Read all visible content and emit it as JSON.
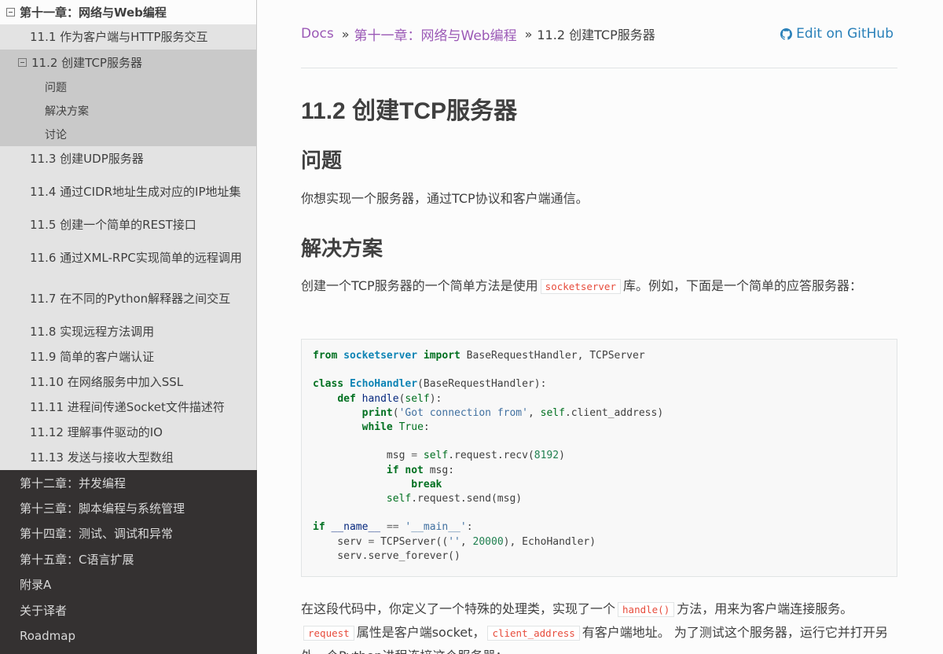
{
  "sidebar": {
    "current_chapter": "第十一章：网络与Web编程",
    "sections_before": [
      "11.1 作为客户端与HTTP服务交互"
    ],
    "current_section": {
      "label": "11.2 创建TCP服务器",
      "subsections": [
        "问题",
        "解决方案",
        "讨论"
      ]
    },
    "sections_after": [
      {
        "label": "11.3 创建UDP服务器",
        "lines": 1
      },
      {
        "label": "11.4 通过CIDR地址生成对应的IP地址集",
        "lines": 2
      },
      {
        "label": "11.5 创建一个简单的REST接口",
        "lines": 1
      },
      {
        "label": "11.6 通过XML-RPC实现简单的远程调用",
        "lines": 2
      },
      {
        "label": "11.7 在不同的Python解释器之间交互",
        "lines": 2
      },
      {
        "label": "11.8 实现远程方法调用",
        "lines": 1
      },
      {
        "label": "11.9 简单的客户端认证",
        "lines": 1
      },
      {
        "label": "11.10 在网络服务中加入SSL",
        "lines": 1
      },
      {
        "label": "11.11 进程间传递Socket文件描述符",
        "lines": 1
      },
      {
        "label": "11.12 理解事件驱动的IO",
        "lines": 1
      },
      {
        "label": "11.13 发送与接收大型数组",
        "lines": 1
      }
    ],
    "other_chapters": [
      "第十二章：并发编程",
      "第十三章：脚本编程与系统管理",
      "第十四章：测试、调试和异常",
      "第十五章：C语言扩展",
      "附录A",
      "关于译者",
      "Roadmap"
    ]
  },
  "breadcrumbs": {
    "docs": "Docs",
    "sep": "»",
    "chapter": "第十一章：网络与Web编程",
    "current": "11.2 创建TCP服务器"
  },
  "edit_link": "Edit on GitHub",
  "page": {
    "title": "11.2 创建TCP服务器",
    "h_problem": "问题",
    "problem_text": "你想实现一个服务器，通过TCP协议和客户端通信。",
    "h_solution": "解决方案",
    "solution_before": "创建一个TCP服务器的一个简单方法是使用",
    "solution_code": "socketserver",
    "solution_after": "库。例如，下面是一个简单的应答服务器：",
    "after_p1": "在这段代码中，你定义了一个特殊的处理类，实现了一个",
    "after_code1": "handle()",
    "after_p2": "方法，用来为客户端连接服务。",
    "after_code2": "request",
    "after_p3": "属性是客户端socket，",
    "after_code3": "client_address",
    "after_p4": "有客户端地址。 为了测试这个服务器，运行它并打开另外一个Python进程连接这个服务器："
  },
  "code": {
    "lines": [
      [
        [
          "kw",
          "from"
        ],
        [
          "t",
          " "
        ],
        [
          "ns",
          "socketserver"
        ],
        [
          "t",
          " "
        ],
        [
          "kw",
          "import"
        ],
        [
          "t",
          " BaseRequestHandler, TCPServer"
        ]
      ],
      [],
      [
        [
          "kw",
          "class"
        ],
        [
          "t",
          " "
        ],
        [
          "cls",
          "EchoHandler"
        ],
        [
          "t",
          "(BaseRequestHandler):"
        ]
      ],
      [
        [
          "t",
          "    "
        ],
        [
          "kw",
          "def"
        ],
        [
          "t",
          " "
        ],
        [
          "fn",
          "handle"
        ],
        [
          "t",
          "("
        ],
        [
          "self",
          "self"
        ],
        [
          "t",
          "):"
        ]
      ],
      [
        [
          "t",
          "        "
        ],
        [
          "kw",
          "print"
        ],
        [
          "t",
          "("
        ],
        [
          "str",
          "'Got connection from'"
        ],
        [
          "t",
          ", "
        ],
        [
          "self",
          "self"
        ],
        [
          "t",
          ".client_address)"
        ]
      ],
      [
        [
          "t",
          "        "
        ],
        [
          "kw",
          "while"
        ],
        [
          "t",
          " "
        ],
        [
          "bi",
          "True"
        ],
        [
          "t",
          ":"
        ]
      ],
      [],
      [
        [
          "t",
          "            msg "
        ],
        [
          "op",
          "="
        ],
        [
          "t",
          " "
        ],
        [
          "self",
          "self"
        ],
        [
          "t",
          ".request.recv("
        ],
        [
          "num",
          "8192"
        ],
        [
          "t",
          ")"
        ]
      ],
      [
        [
          "t",
          "            "
        ],
        [
          "kw",
          "if"
        ],
        [
          "t",
          " "
        ],
        [
          "opw",
          "not"
        ],
        [
          "t",
          " msg:"
        ]
      ],
      [
        [
          "t",
          "                "
        ],
        [
          "kw",
          "break"
        ]
      ],
      [
        [
          "t",
          "            "
        ],
        [
          "self",
          "self"
        ],
        [
          "t",
          ".request.send(msg)"
        ]
      ],
      [],
      [
        [
          "kw",
          "if"
        ],
        [
          "t",
          " "
        ],
        [
          "fn",
          "__name__"
        ],
        [
          "t",
          " "
        ],
        [
          "op",
          "=="
        ],
        [
          "t",
          " "
        ],
        [
          "str",
          "'__main__'"
        ],
        [
          "t",
          ":"
        ]
      ],
      [
        [
          "t",
          "    serv "
        ],
        [
          "op",
          "="
        ],
        [
          "t",
          " TCPServer(("
        ],
        [
          "str",
          "''"
        ],
        [
          "t",
          ", "
        ],
        [
          "num",
          "20000"
        ],
        [
          "t",
          "), EchoHandler)"
        ]
      ],
      [
        [
          "t",
          "    serv.serve_forever()"
        ]
      ]
    ]
  }
}
